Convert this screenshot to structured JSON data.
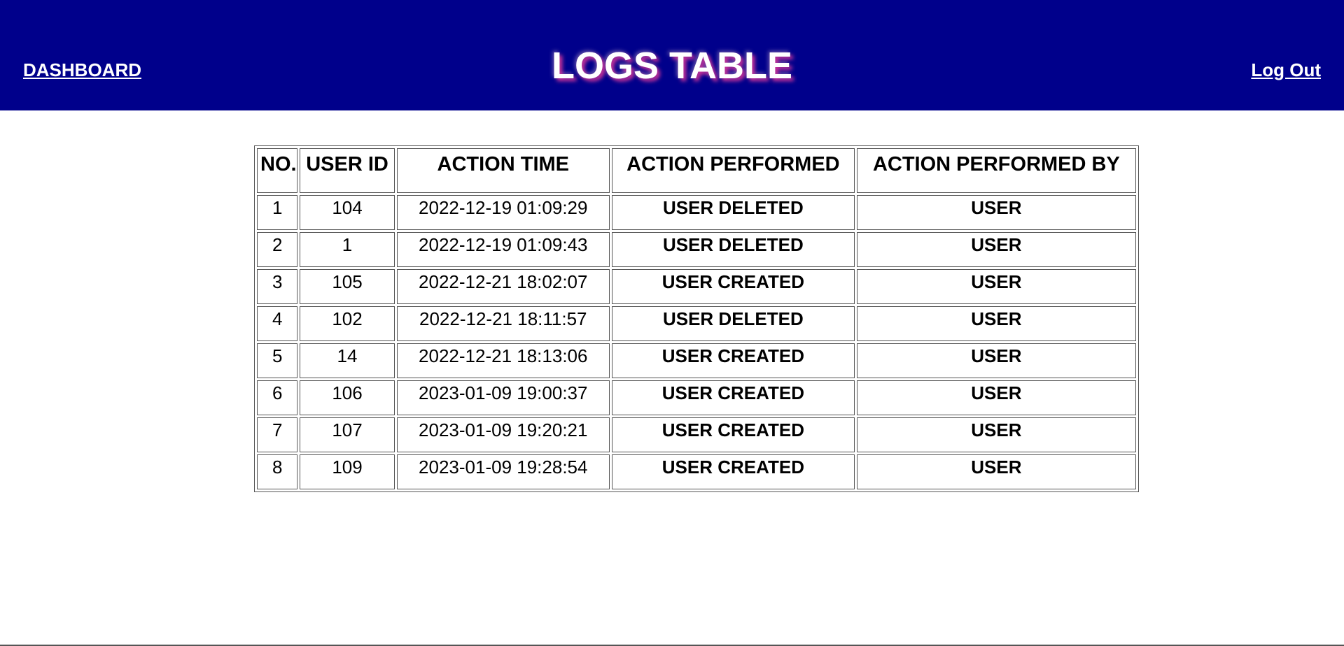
{
  "header": {
    "dashboard_label": "DASHBOARD",
    "title": "LOGS TABLE",
    "logout_label": "Log Out"
  },
  "colors": {
    "header_bg": "#00008b",
    "title_glow": "#cc3399"
  },
  "table": {
    "columns": [
      "NO.",
      "USER ID",
      "ACTION TIME",
      "ACTION PERFORMED",
      "ACTION PERFORMED BY"
    ],
    "rows": [
      [
        "1",
        "104",
        "2022-12-19 01:09:29",
        "USER DELETED",
        "USER"
      ],
      [
        "2",
        "1",
        "2022-12-19 01:09:43",
        "USER DELETED",
        "USER"
      ],
      [
        "3",
        "105",
        "2022-12-21 18:02:07",
        "USER CREATED",
        "USER"
      ],
      [
        "4",
        "102",
        "2022-12-21 18:11:57",
        "USER DELETED",
        "USER"
      ],
      [
        "5",
        "14",
        "2022-12-21 18:13:06",
        "USER CREATED",
        "USER"
      ],
      [
        "6",
        "106",
        "2023-01-09 19:00:37",
        "USER CREATED",
        "USER"
      ],
      [
        "7",
        "107",
        "2023-01-09 19:20:21",
        "USER CREATED",
        "USER"
      ],
      [
        "8",
        "109",
        "2023-01-09 19:28:54",
        "USER CREATED",
        "USER"
      ]
    ]
  }
}
